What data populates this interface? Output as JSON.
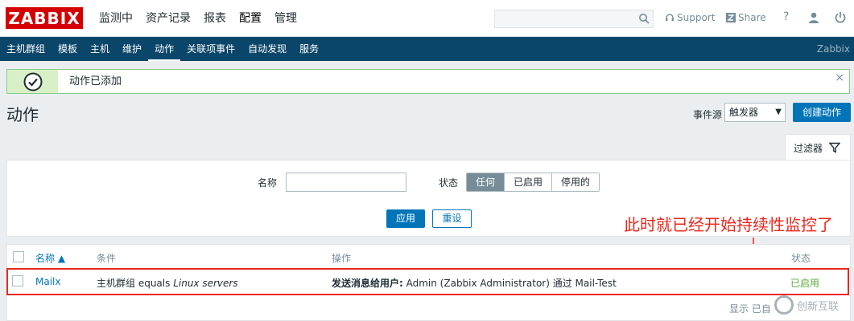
{
  "header": {
    "logo": "ZABBIX",
    "menu": [
      "监测中",
      "资产记录",
      "报表",
      "配置",
      "管理"
    ],
    "active_menu": "配置",
    "search_placeholder": "",
    "support_label": "Support",
    "share_label": "Share",
    "help_label": "?"
  },
  "submenu": {
    "items": [
      "主机群组",
      "模板",
      "主机",
      "维护",
      "动作",
      "关联项事件",
      "自动发现",
      "服务"
    ],
    "active": "动作",
    "brand": "Zabbix"
  },
  "message": {
    "text": "动作已添加",
    "close": "×"
  },
  "page": {
    "title": "动作",
    "event_source_label": "事件源",
    "event_source_value": "触发器",
    "create_button": "创建动作"
  },
  "filter": {
    "tab_label": "过滤器",
    "name_label": "名称",
    "name_value": "",
    "status_label": "状态",
    "status_options": [
      "任何",
      "已启用",
      "停用的"
    ],
    "status_selected": "任何",
    "apply_button": "应用",
    "reset_button": "重设"
  },
  "annotation": "此时就已经开始持续性监控了",
  "table": {
    "columns": [
      "名称 ▲",
      "条件",
      "操作",
      "状态"
    ],
    "rows": [
      {
        "name": "Mailx",
        "condition_prefix": "主机群组 equals ",
        "condition_value": "Linux servers",
        "operation_bold": "发送消息给用户:",
        "operation_rest": " Admin (Zabbix Administrator) 通过 Mail-Test",
        "status": "已启用"
      }
    ],
    "footer": "显示 已自"
  },
  "watermark": {
    "name": "创新互联"
  },
  "colors": {
    "brand_red": "#d40000",
    "nav_blue": "#0a466a",
    "primary": "#0275b8",
    "success": "#59a83b",
    "annotation_red": "#e8281d"
  }
}
